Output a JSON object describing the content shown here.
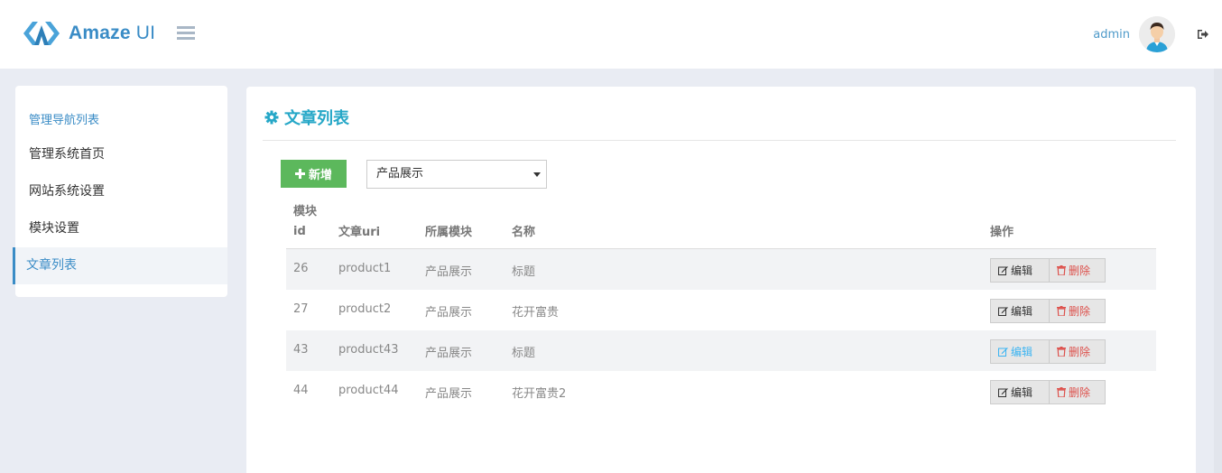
{
  "header": {
    "logo_main": "Amaze",
    "logo_sub": "UI",
    "user_name": "admin"
  },
  "sidebar": {
    "title": "管理导航列表",
    "items": [
      {
        "label": "管理系统首页"
      },
      {
        "label": "网站系统设置"
      },
      {
        "label": "模块设置"
      },
      {
        "label": "文章列表"
      }
    ]
  },
  "main": {
    "title": "文章列表",
    "add_label": "新增",
    "select_value": "产品展示",
    "columns": {
      "id_top": "模块",
      "id_bottom": "id",
      "uri": "文章uri",
      "module": "所属模块",
      "name": "名称",
      "ops": "操作"
    },
    "rows": [
      {
        "id": "26",
        "uri": "product1",
        "module": "产品展示",
        "name": "标题"
      },
      {
        "id": "27",
        "uri": "product2",
        "module": "产品展示",
        "name": "花开富贵"
      },
      {
        "id": "43",
        "uri": "product43",
        "module": "产品展示",
        "name": "标题"
      },
      {
        "id": "44",
        "uri": "product44",
        "module": "产品展示",
        "name": "花开富贵2"
      }
    ],
    "edit_label": "编辑",
    "delete_label": "删除"
  },
  "colors": {
    "accent": "#3a8cc6",
    "title": "#25a7c7",
    "success": "#5cb85c",
    "danger": "#dd514c"
  },
  "icons": {
    "menu": "list-icon",
    "logout": "sign-out-icon",
    "title": "gear-icon",
    "add": "plus-icon",
    "edit": "pencil-square-icon",
    "delete": "trash-icon"
  }
}
